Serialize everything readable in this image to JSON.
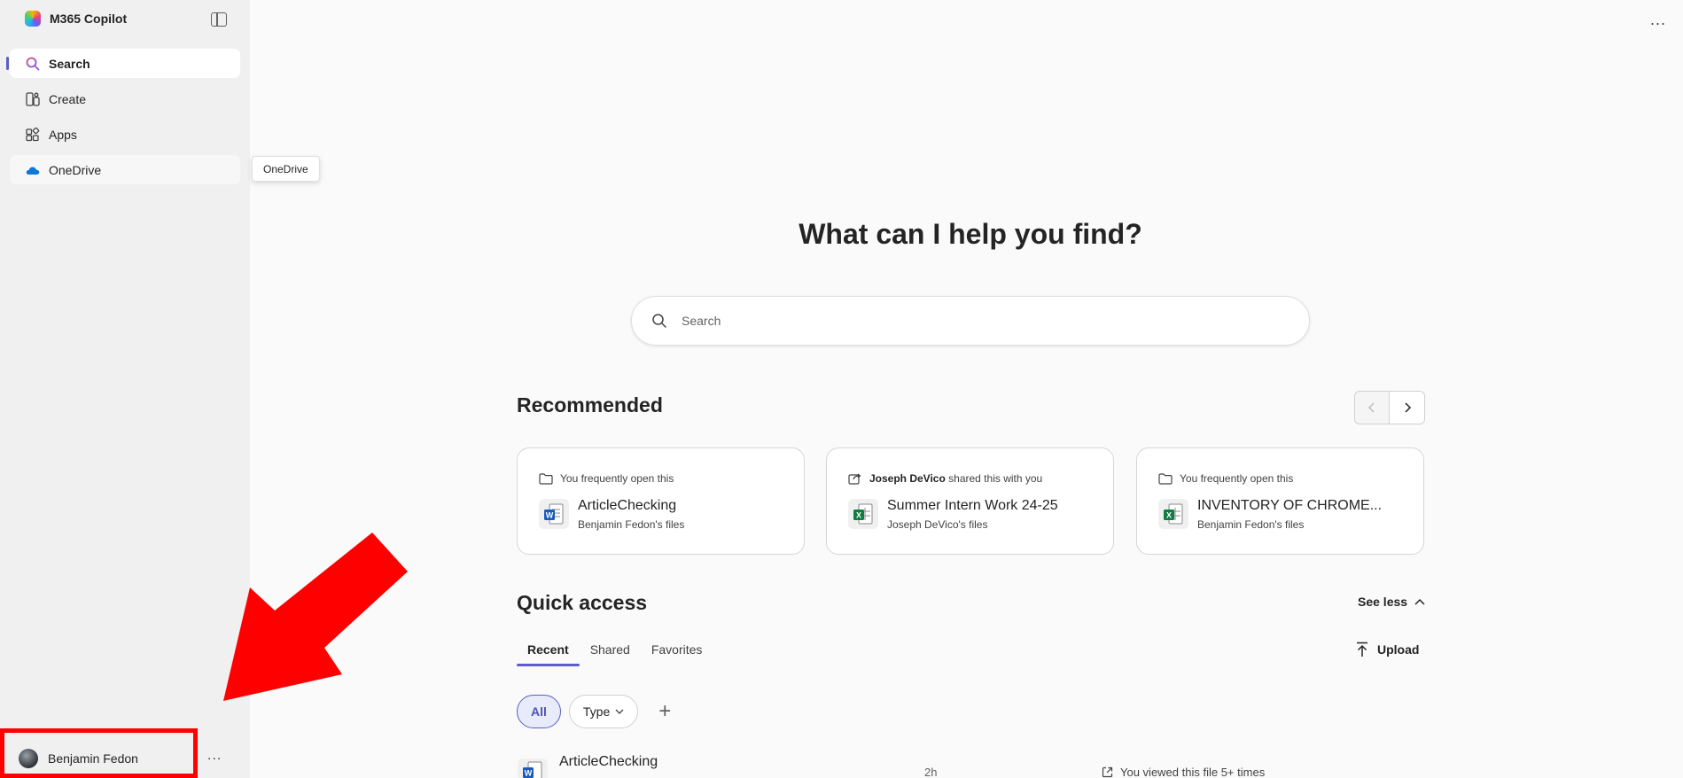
{
  "app": {
    "title": "M365 Copilot"
  },
  "sidebar": {
    "items": [
      {
        "label": "Search",
        "icon": "search-icon"
      },
      {
        "label": "Create",
        "icon": "create-icon"
      },
      {
        "label": "Apps",
        "icon": "apps-icon"
      },
      {
        "label": "OneDrive",
        "icon": "onedrive-icon"
      }
    ],
    "tooltip": "OneDrive",
    "user": {
      "name": "Benjamin Fedon"
    },
    "more": "..."
  },
  "main": {
    "more": "...",
    "heading": "What can I help you find?",
    "search": {
      "placeholder": "Search"
    },
    "recommended": {
      "title": "Recommended",
      "cards": [
        {
          "reason_prefix": "",
          "reason": "You frequently open this",
          "title": "ArticleChecking",
          "subtitle": "Benjamin Fedon's files",
          "file_type": "word"
        },
        {
          "reason_prefix": "Joseph DeVico",
          "reason": "shared this with you",
          "title": "Summer Intern Work 24-25",
          "subtitle": "Joseph DeVico's files",
          "file_type": "excel"
        },
        {
          "reason_prefix": "",
          "reason": "You frequently open this",
          "title": "INVENTORY OF CHROME...",
          "subtitle": "Benjamin Fedon's files",
          "file_type": "excel"
        }
      ]
    },
    "quick_access": {
      "title": "Quick access",
      "see_less": "See less",
      "tabs": [
        "Recent",
        "Shared",
        "Favorites"
      ],
      "upload": "Upload",
      "filters": {
        "all": "All",
        "type": "Type"
      },
      "rows": [
        {
          "name": "ArticleChecking",
          "time": "2h",
          "activity": "You viewed this file 5+ times"
        }
      ]
    }
  },
  "colors": {
    "accent": "#5b5fc7",
    "highlight": "#ff0000",
    "word": "#185abd",
    "excel": "#107c41"
  }
}
